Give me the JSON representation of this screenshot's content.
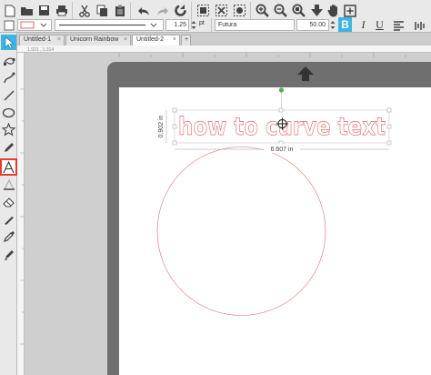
{
  "toolbar": {
    "line_weight": "1.25",
    "line_unit": "pt",
    "font_name": "Futura",
    "font_size": "50.00",
    "bold_label": "B",
    "italic_label": "I",
    "underline_label": "U",
    "icons": [
      "new-document-icon",
      "open-folder-icon",
      "save-icon",
      "print-icon",
      "cut-icon",
      "copy-icon",
      "paste-icon",
      "undo-icon",
      "redo-icon",
      "rotate-icon",
      "select-all-icon",
      "deselect-icon",
      "trace-icon",
      "zoom-in-icon",
      "zoom-out-icon",
      "zoom-fit-icon",
      "send-icon",
      "pan-icon",
      "add-page-icon"
    ]
  },
  "tabs": [
    {
      "label": "Untitled-1",
      "close": "×"
    },
    {
      "label": "Unicorn Rainbow",
      "close": "×"
    },
    {
      "label": "Untitled-2",
      "close": "×",
      "active": true
    }
  ],
  "add_tab": "+",
  "ruler": {
    "coordinates": "1.921 , 1.314"
  },
  "tools": [
    "select-arrow-icon",
    "edit-points-icon",
    "draw-curve-icon",
    "line-icon",
    "ellipse-icon",
    "star-icon",
    "pencil-icon",
    "text-tool-icon",
    "eraser-icon",
    "knife-icon",
    "eyedropper-icon",
    "paint-bucket-icon"
  ],
  "active_tool": "text-tool-icon",
  "canvas": {
    "text": "how to curve text",
    "height_label": "0.902 in",
    "width_label": "6.607 in"
  },
  "colors": {
    "outline": "#e46a6a",
    "active_tool": "#e23c2e",
    "bold_button": "#3fb3e6",
    "mat": "#6f6f6f",
    "handle_green": "#4caf50"
  }
}
